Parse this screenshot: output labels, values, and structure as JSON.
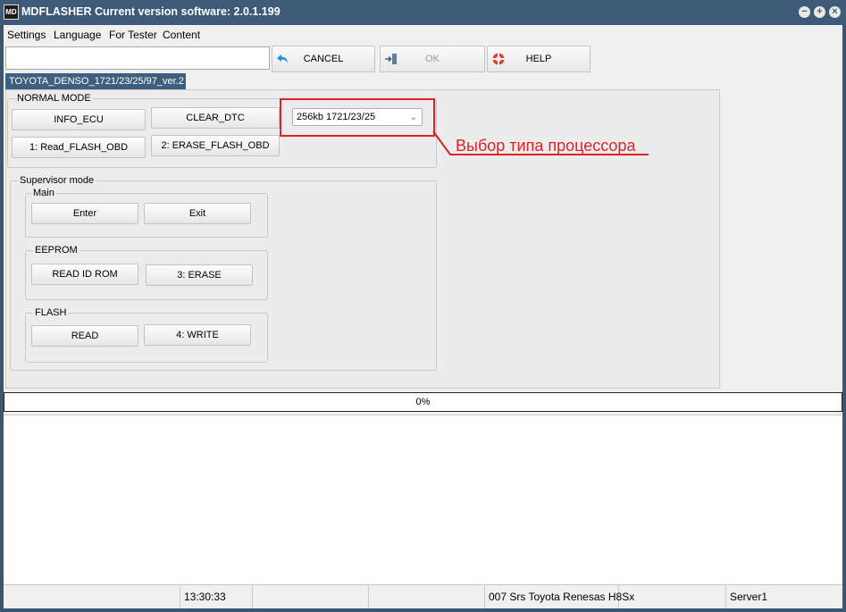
{
  "window": {
    "icon_text": "MD",
    "title": "MDFLASHER  Current version software: 2.0.1.199",
    "controls": {
      "minimize": "−",
      "maximize": "+",
      "close": "×"
    }
  },
  "menu": [
    "Settings",
    "Language",
    "For Tester",
    "Content"
  ],
  "toolbar": {
    "input_value": "",
    "cancel_label": "CANCEL",
    "ok_label": "OK",
    "help_label": "HELP"
  },
  "tab_label": "TOYOTA_DENSO_1721/23/25/97_ver.2",
  "normal_mode": {
    "title": "NORMAL MODE",
    "info_ecu": "INFO_ECU",
    "clear_dtc": "CLEAR_DTC",
    "read_flash_obd": "1: Read_FLASH_OBD",
    "erase_flash_obd": "2: ERASE_FLASH_OBD",
    "processor_select": "256kb 1721/23/25"
  },
  "annotation_text": "Выбор типа процессора",
  "supervisor": {
    "title": "Supervisor mode",
    "main": {
      "title": "Main",
      "enter": "Enter",
      "exit": "Exit"
    },
    "eeprom": {
      "title": "EEPROM",
      "read_id_rom": "READ ID ROM",
      "erase": "3: ERASE"
    },
    "flash": {
      "title": "FLASH",
      "read": "READ",
      "write": "4: WRITE"
    }
  },
  "progress": {
    "value": 0,
    "label": "0%"
  },
  "status": {
    "cell1": "",
    "time": "13:30:33",
    "cell3": "",
    "cell4": "",
    "device": "007 Srs Toyota Renesas H8Sx",
    "cell6": "",
    "server": "Server1"
  },
  "colors": {
    "titlebar": "#3d5a78",
    "tab": "#3f5f80",
    "annotation": "#e0202a"
  }
}
